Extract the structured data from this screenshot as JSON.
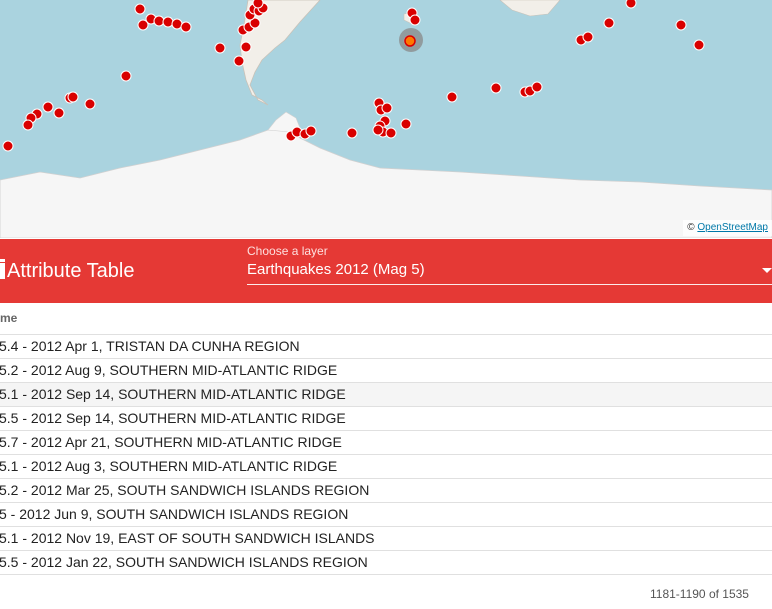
{
  "map": {
    "attribution_symbol": "©",
    "attribution_link": "OpenStreetMap",
    "marker_color": "#d90000",
    "selected_marker_color": "#ff7800"
  },
  "toolbar": {
    "title": "Attribute Table",
    "layer_label": "Choose a layer",
    "layer_value": "Earthquakes 2012 (Mag 5)",
    "background": "#e53935"
  },
  "table": {
    "column_header": "me",
    "rows": [
      {
        "text": "5.4 - 2012 Apr 1, TRISTAN DA CUNHA REGION"
      },
      {
        "text": "5.2 - 2012 Aug 9, SOUTHERN MID-ATLANTIC RIDGE"
      },
      {
        "text": "5.1 - 2012 Sep 14, SOUTHERN MID-ATLANTIC RIDGE"
      },
      {
        "text": "5.5 - 2012 Sep 14, SOUTHERN MID-ATLANTIC RIDGE"
      },
      {
        "text": "5.7 - 2012 Apr 21, SOUTHERN MID-ATLANTIC RIDGE"
      },
      {
        "text": "5.1 - 2012 Aug 3, SOUTHERN MID-ATLANTIC RIDGE"
      },
      {
        "text": "5.2 - 2012 Mar 25, SOUTH SANDWICH ISLANDS REGION"
      },
      {
        "text": "5 - 2012 Jun 9, SOUTH SANDWICH ISLANDS REGION"
      },
      {
        "text": "5.1 - 2012 Nov 19, EAST OF SOUTH SANDWICH ISLANDS"
      },
      {
        "text": "5.5 - 2012 Jan 22, SOUTH SANDWICH ISLANDS REGION"
      }
    ]
  },
  "pagination": {
    "text": "1181-1190 of 1535"
  }
}
